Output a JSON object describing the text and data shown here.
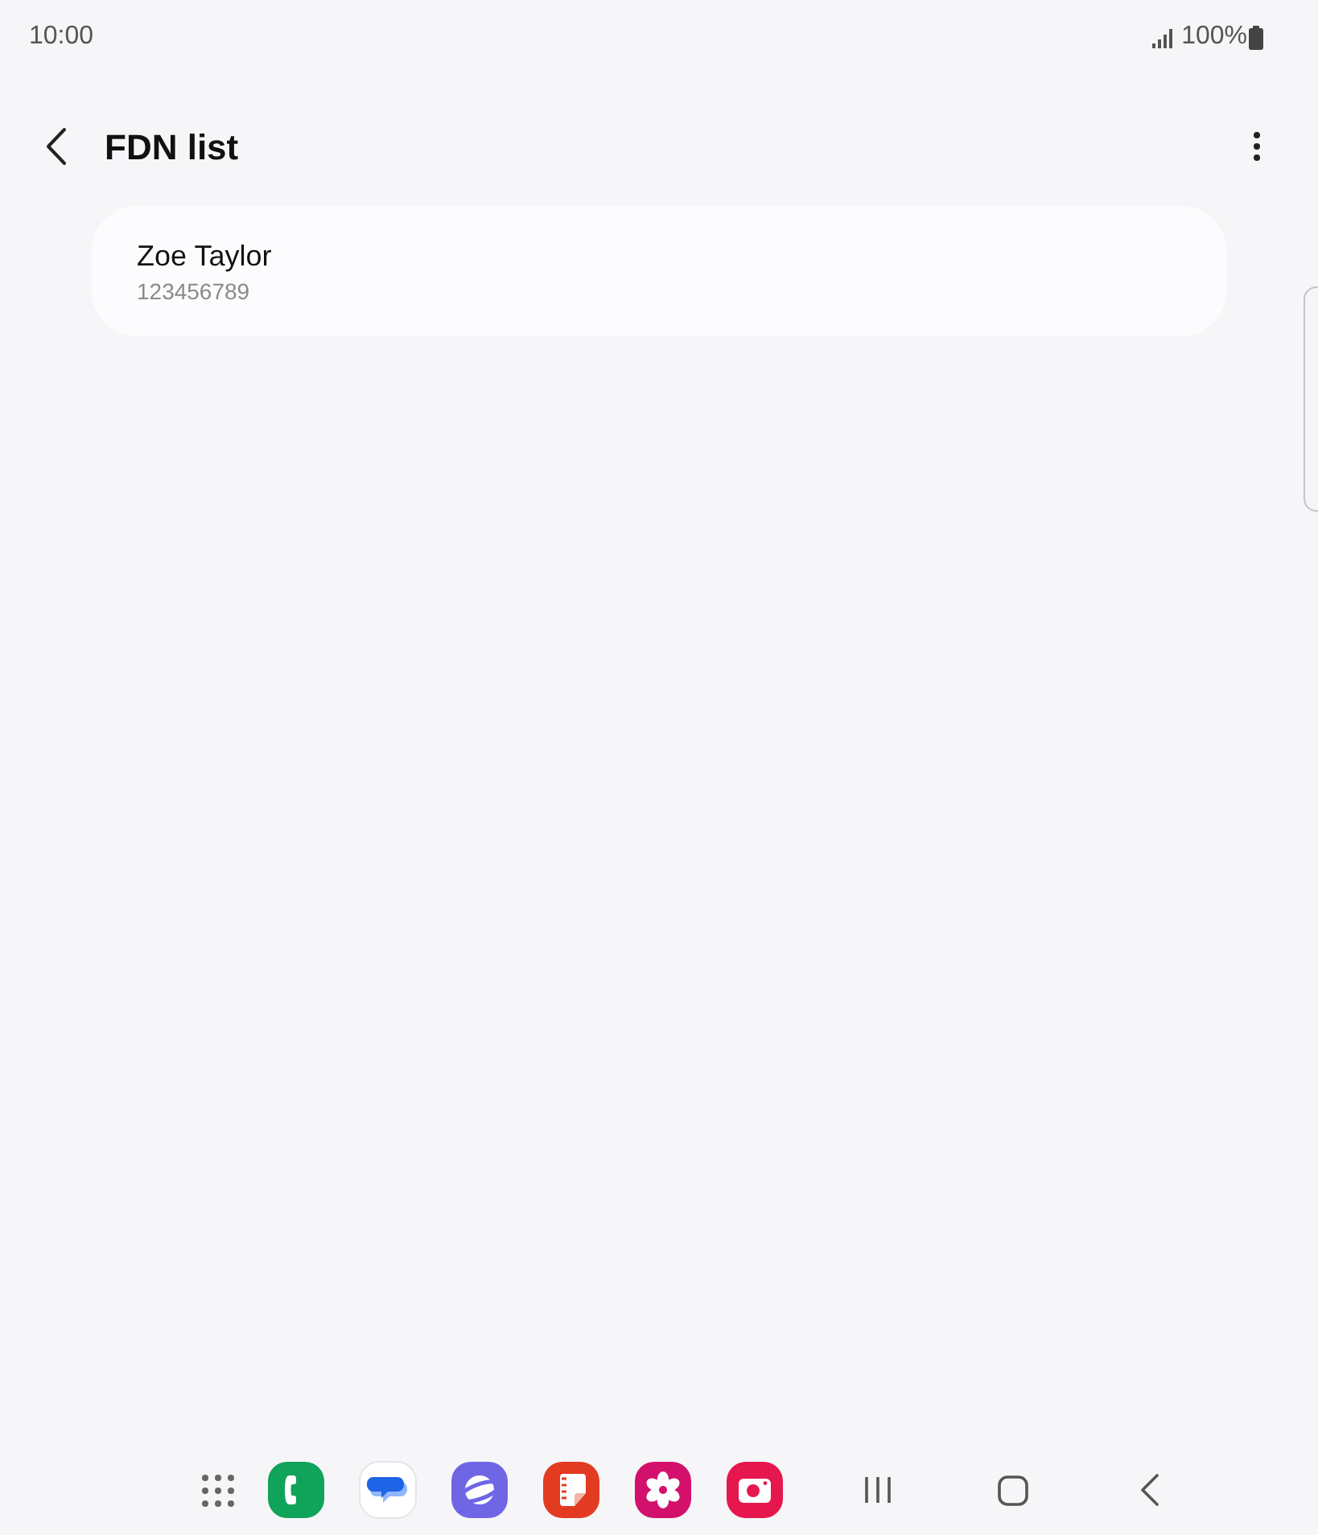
{
  "status_bar": {
    "time": "10:00",
    "battery": "100%"
  },
  "header": {
    "title": "FDN list"
  },
  "contacts": [
    {
      "name": "Zoe Taylor",
      "number": "123456789"
    }
  ]
}
